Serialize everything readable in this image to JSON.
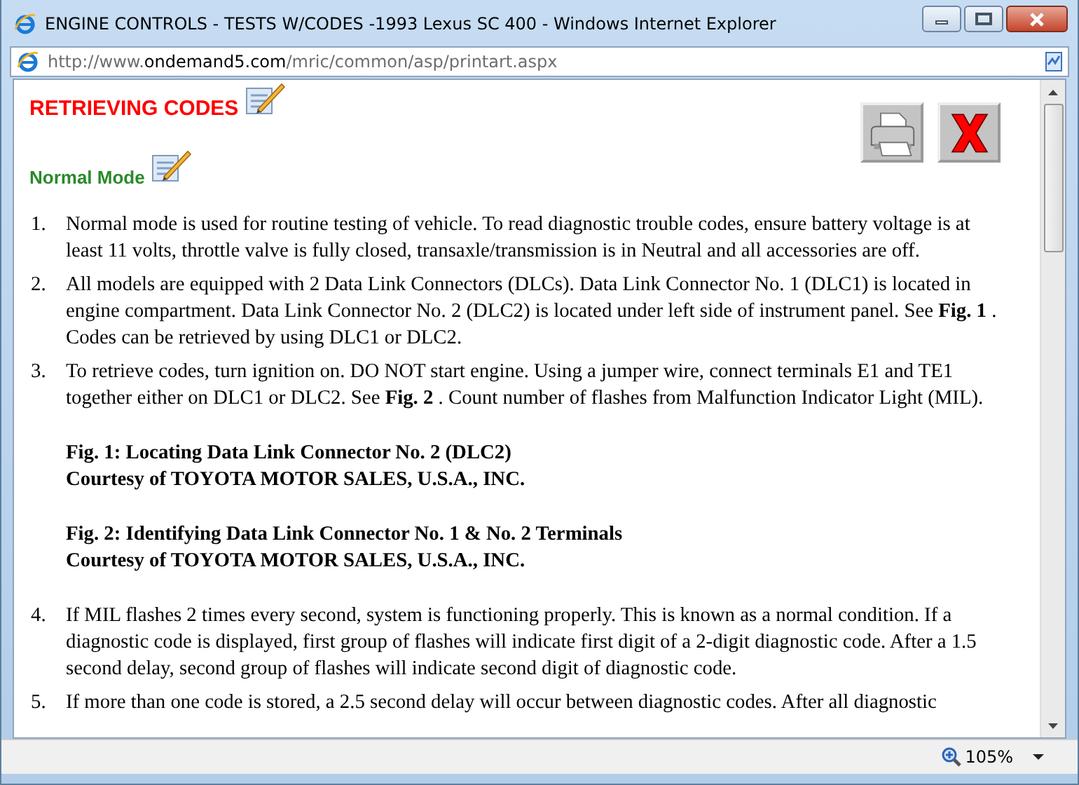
{
  "window": {
    "title": "ENGINE CONTROLS - TESTS W/CODES -1993 Lexus SC 400 - Windows Internet Explorer"
  },
  "address_bar": {
    "prefix": "http://www.",
    "domain": "ondemand5.com",
    "path": "/mric/common/asp/printart.aspx"
  },
  "page": {
    "heading": "RETRIEVING CODES",
    "subheading": "Normal Mode",
    "items": [
      {
        "kind": "step",
        "number": "1.",
        "text": "Normal mode is used for routine testing of vehicle. To read diagnostic trouble codes, ensure battery voltage is at least 11 volts, throttle valve is fully closed, transaxle/transmission is in Neutral and all accessories are off."
      },
      {
        "kind": "step",
        "number": "2.",
        "text": "All models are equipped with 2 Data Link Connectors (DLCs). Data Link Connector No. 1 (DLC1) is located in engine compartment. Data Link Connector No. 2 (DLC2) is located under left side of instrument panel. See **Fig. 1** . Codes can be retrieved by using DLC1 or DLC2."
      },
      {
        "kind": "step",
        "number": "3.",
        "text": "To retrieve codes, turn ignition on. DO NOT start engine. Using a jumper wire, connect terminals E1 and TE1 together either on DLC1 or DLC2. See **Fig. 2** . Count number of flashes from Malfunction Indicator Light (MIL)."
      },
      {
        "kind": "figure",
        "title": "Fig. 1: Locating Data Link Connector No. 2 (DLC2)",
        "credit": "Courtesy of TOYOTA MOTOR SALES, U.S.A., INC."
      },
      {
        "kind": "figure",
        "title": "Fig. 2: Identifying Data Link Connector No. 1 & No. 2 Terminals",
        "credit": "Courtesy of TOYOTA MOTOR SALES, U.S.A., INC."
      },
      {
        "kind": "step",
        "number": "4.",
        "text": "If MIL flashes 2 times every second, system is functioning properly. This is known as a normal condition. If a diagnostic code is displayed, first group of flashes will indicate first digit of a 2-digit diagnostic code. After a 1.5 second delay, second group of flashes will indicate second digit of diagnostic code."
      },
      {
        "kind": "step",
        "number": "5.",
        "text": "If more than one code is stored, a 2.5 second delay will occur between diagnostic codes. After all diagnostic"
      }
    ]
  },
  "status_bar": {
    "zoom": "105%"
  }
}
